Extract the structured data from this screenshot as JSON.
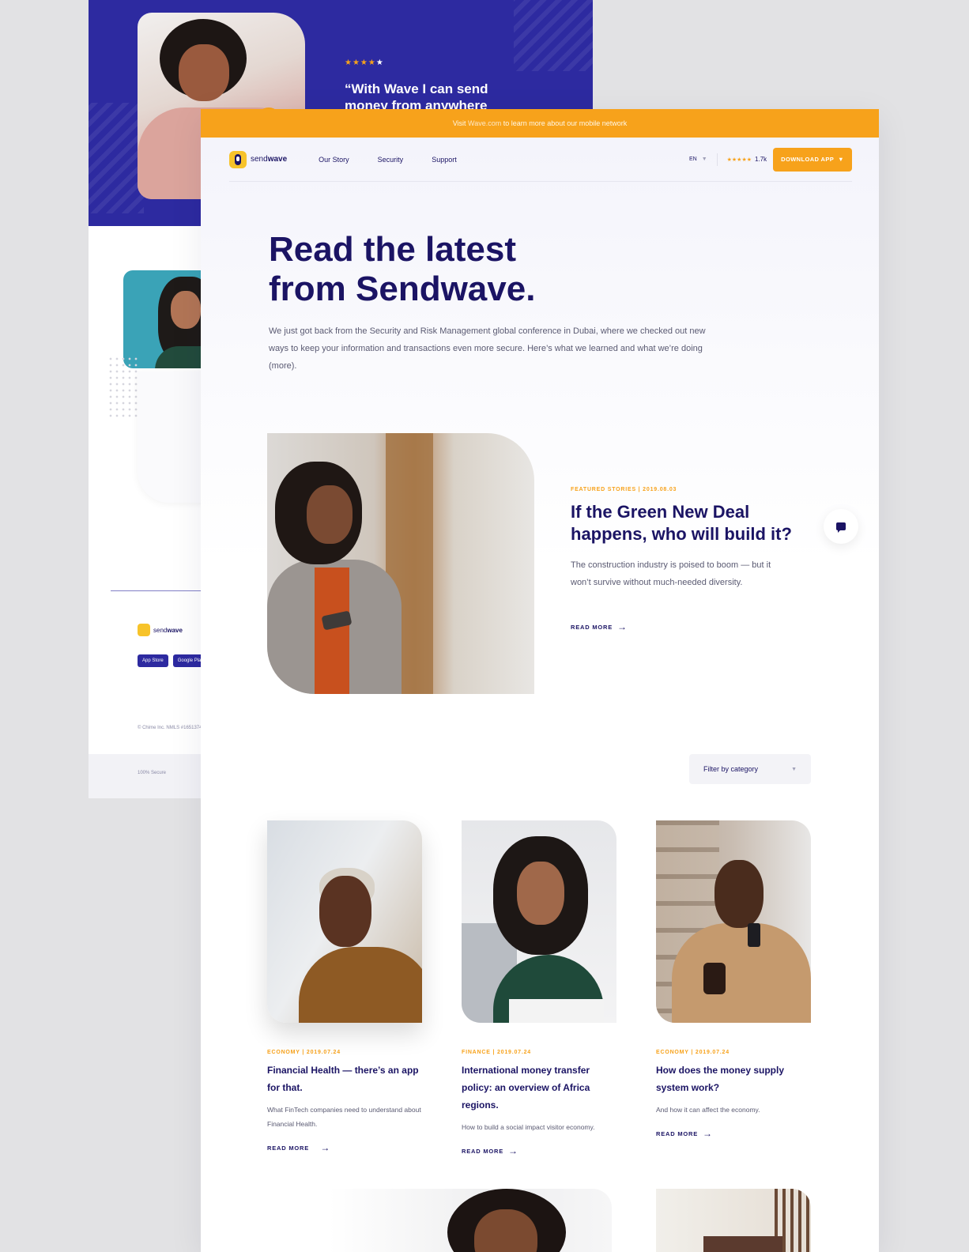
{
  "background_page": {
    "rating_stars": "★★★★",
    "rating_star_last": "★",
    "quote": "“With Wave I can send money from anywhere",
    "logo_text_a": "send",
    "logo_text_b": "wave",
    "badges": [
      "App Store",
      "Google Play"
    ],
    "copyright": "© Chime Inc. NMLS #1651374",
    "footer_note": "100% Secure"
  },
  "topbar": {
    "text_before": "Visit ",
    "link": "Wave.com",
    "text_after": " to learn more about our mobile network"
  },
  "nav": {
    "logo_a": "send",
    "logo_b": "wave",
    "links": [
      "Our Story",
      "Security",
      "Support"
    ],
    "language": "EN",
    "rating_stars": "★★★★★",
    "rating_count": "1.7k",
    "download_label": "DOWNLOAD APP"
  },
  "hero": {
    "title_line1": "Read the latest",
    "title_line2": "from Sendwave.",
    "subtitle": "We just got back from the Security and Risk Management global conference in Dubai, where we checked out new ways to keep your information and transactions even more secure. Here’s what we learned and what we’re doing (more)."
  },
  "featured": {
    "meta": "FEATURED STORIES | 2019.08.03",
    "title": "If the Green New Deal happens, who will build it?",
    "description": "The construction industry is poised to boom — but it won’t survive without much-needed diversity.",
    "read_more": "READ MORE"
  },
  "filter": {
    "label": "Filter by category"
  },
  "cards": [
    {
      "meta": "ECONOMY | 2019.07.24",
      "title": "Financial Health — there’s an app for that.",
      "description": "What FinTech companies need to understand about Financial Health.",
      "read_more": "READ MORE"
    },
    {
      "meta": "FINANCE | 2019.07.24",
      "title": "International money transfer policy: an overview of Africa regions.",
      "description": "How to build a social impact visitor economy.",
      "read_more": "READ MORE"
    },
    {
      "meta": "ECONOMY | 2019.07.24",
      "title": "How does the money supply system work?",
      "description": "And how it can affect the economy.",
      "read_more": "READ MORE"
    }
  ],
  "colors": {
    "accent": "#f7a21b",
    "navy": "#1b1464",
    "hero_blue": "#2d2aa0"
  },
  "icons": {
    "play": "play-icon",
    "arrow": "arrow-right-icon",
    "chevron": "chevron-down-icon",
    "chat": "chat-icon"
  }
}
